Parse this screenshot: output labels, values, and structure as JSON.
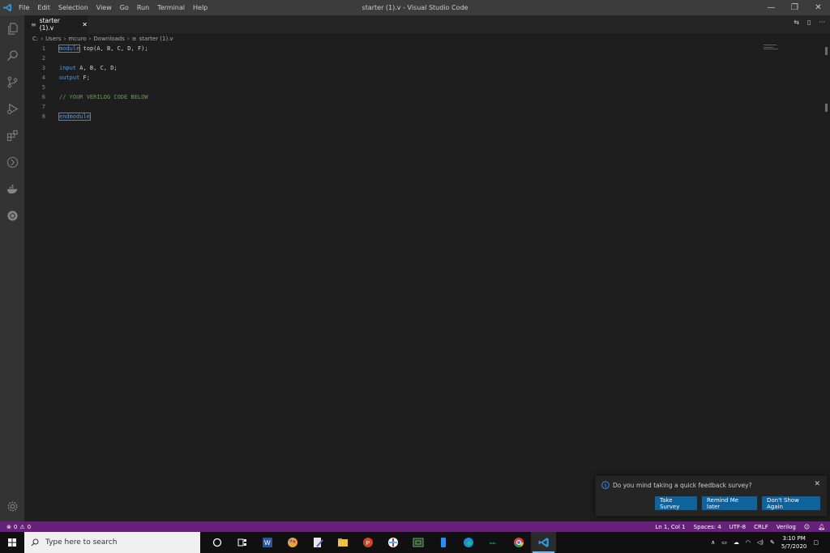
{
  "titlebar": {
    "menu": [
      "File",
      "Edit",
      "Selection",
      "View",
      "Go",
      "Run",
      "Terminal",
      "Help"
    ],
    "title": "starter (1).v - Visual Studio Code"
  },
  "tab": {
    "label": "starter (1).v"
  },
  "breadcrumb": [
    "C:",
    "Users",
    "mcuro",
    "Downloads",
    "starter (1).v"
  ],
  "editor": {
    "lines": [
      {
        "num": "1",
        "text": "module top(A, B, C, D, F);"
      },
      {
        "num": "2",
        "text": ""
      },
      {
        "num": "3",
        "text": "input A, B, C, D;"
      },
      {
        "num": "4",
        "text": "output F;"
      },
      {
        "num": "5",
        "text": ""
      },
      {
        "num": "6",
        "text": "// YOUR VERILOG CODE BELOW"
      },
      {
        "num": "7",
        "text": ""
      },
      {
        "num": "8",
        "text": "endmodule"
      }
    ]
  },
  "statusbar": {
    "errors": "0",
    "warnings": "0",
    "position": "Ln 1, Col 1",
    "spaces": "Spaces: 4",
    "encoding": "UTF-8",
    "eol": "CRLF",
    "language": "Verilog"
  },
  "toast": {
    "message": "Do you mind taking a quick feedback survey?",
    "take_survey": "Take Survey",
    "remind_later": "Remind Me later",
    "dont_show": "Don't Show Again"
  },
  "taskbar": {
    "search_placeholder": "Type here to search",
    "time": "3:10 PM",
    "date": "5/7/2020"
  },
  "colors": {
    "statusbar": "#68217a",
    "button": "#0e639c",
    "keyword": "#569cd6",
    "comment": "#6a9955"
  }
}
